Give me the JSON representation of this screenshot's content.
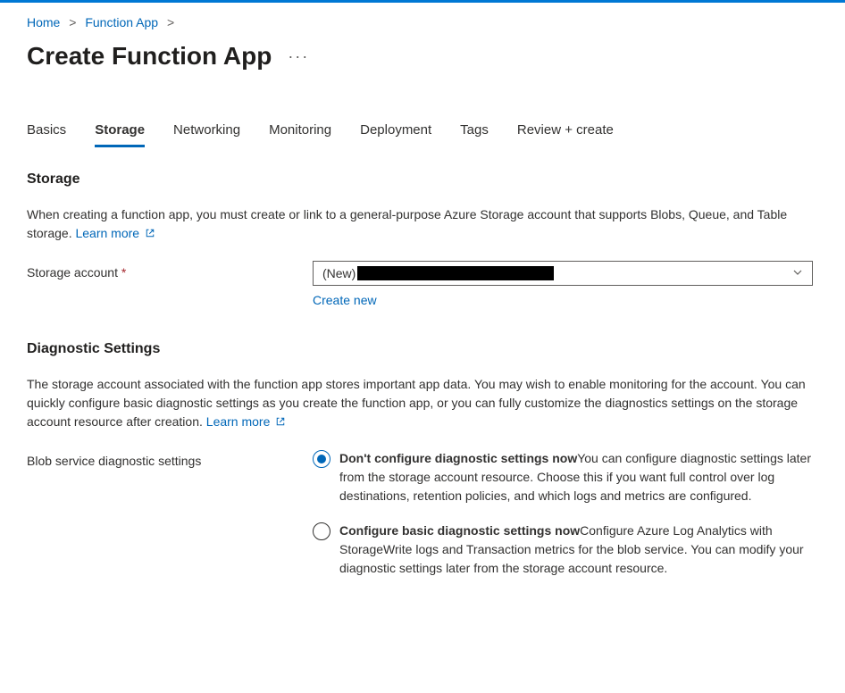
{
  "breadcrumb": {
    "items": [
      "Home",
      "Function App"
    ]
  },
  "page": {
    "title": "Create Function App"
  },
  "tabs": {
    "items": [
      {
        "label": "Basics"
      },
      {
        "label": "Storage"
      },
      {
        "label": "Networking"
      },
      {
        "label": "Monitoring"
      },
      {
        "label": "Deployment"
      },
      {
        "label": "Tags"
      },
      {
        "label": "Review + create"
      }
    ],
    "active_index": 1
  },
  "storage_section": {
    "heading": "Storage",
    "desc": "When creating a function app, you must create or link to a general-purpose Azure Storage account that supports Blobs, Queue, and Table storage. ",
    "learn_more": "Learn more",
    "field_label": "Storage account",
    "select_prefix": "(New)",
    "create_new": "Create new"
  },
  "diagnostic_section": {
    "heading": "Diagnostic Settings",
    "desc": "The storage account associated with the function app stores important app data. You may wish to enable monitoring for the account. You can quickly configure basic diagnostic settings as you create the function app, or you can fully customize the diagnostics settings on the storage account resource after creation. ",
    "learn_more": "Learn more",
    "field_label": "Blob service diagnostic settings",
    "options": [
      {
        "title": "Don't configure diagnostic settings now",
        "desc": "You can configure diagnostic settings later from the storage account resource. Choose this if you want full control over log destinations, retention policies, and which logs and metrics are configured.",
        "selected": true
      },
      {
        "title": "Configure basic diagnostic settings now",
        "desc": "Configure Azure Log Analytics with StorageWrite logs and Transaction metrics for the blob service. You can modify your diagnostic settings later from the storage account resource.",
        "selected": false
      }
    ]
  }
}
